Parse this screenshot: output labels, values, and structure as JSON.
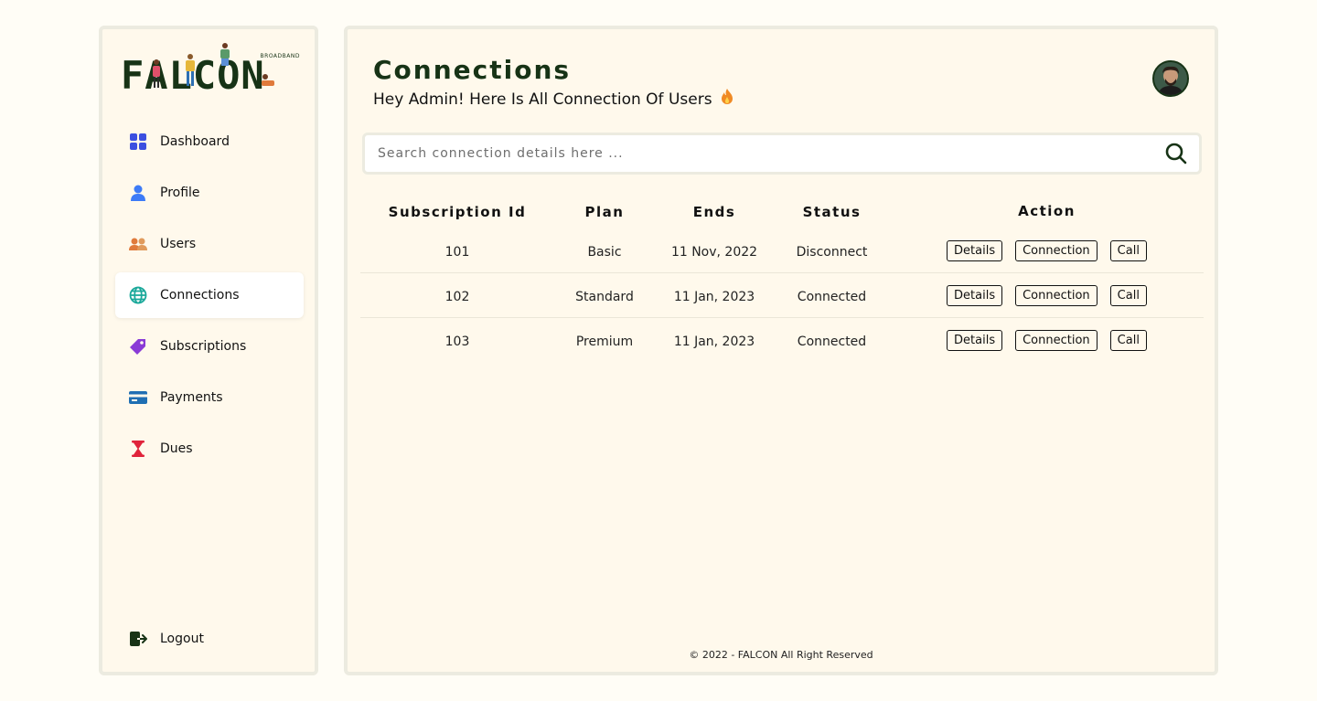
{
  "brand": {
    "name": "FALCON",
    "tagline": "BROADBAND"
  },
  "sidebar": {
    "items": [
      {
        "label": "Dashboard",
        "icon": "dashboard-grid-icon",
        "color": "#3b4fe0",
        "active": false
      },
      {
        "label": "Profile",
        "icon": "user-icon",
        "color": "#3d7bf7",
        "active": false
      },
      {
        "label": "Users",
        "icon": "users-icon",
        "color": "#e07a3b",
        "active": false
      },
      {
        "label": "Connections",
        "icon": "globe-icon",
        "color": "#1aa89a",
        "active": true
      },
      {
        "label": "Subscriptions",
        "icon": "tags-icon",
        "color": "#8a3bd6",
        "active": false
      },
      {
        "label": "Payments",
        "icon": "credit-card-icon",
        "color": "#1f6fb3",
        "active": false
      },
      {
        "label": "Dues",
        "icon": "hourglass-icon",
        "color": "#e0243b",
        "active": false
      }
    ],
    "logout": {
      "label": "Logout",
      "icon": "logout-icon"
    }
  },
  "header": {
    "title": "Connections",
    "subtitle": "Hey Admin! Here Is All Connection Of Users",
    "subtitle_icon": "fire-icon"
  },
  "search": {
    "placeholder": "Search connection details here ..."
  },
  "table": {
    "columns": [
      "Subscription Id",
      "Plan",
      "Ends",
      "Status",
      "Action"
    ],
    "rows": [
      {
        "id": "101",
        "plan": "Basic",
        "ends": "11 Nov, 2022",
        "status": "Disconnect"
      },
      {
        "id": "102",
        "plan": "Standard",
        "ends": "11 Jan, 2023",
        "status": "Connected"
      },
      {
        "id": "103",
        "plan": "Premium",
        "ends": "11 Jan, 2023",
        "status": "Connected"
      }
    ],
    "actions": [
      "Details",
      "Connection",
      "Call"
    ]
  },
  "footer": {
    "text": "© 2022 - FALCON All Right Reserved"
  },
  "colors": {
    "brand_dark": "#173316",
    "panel_bg": "#fff9ec",
    "page_bg": "#fffdf6"
  }
}
